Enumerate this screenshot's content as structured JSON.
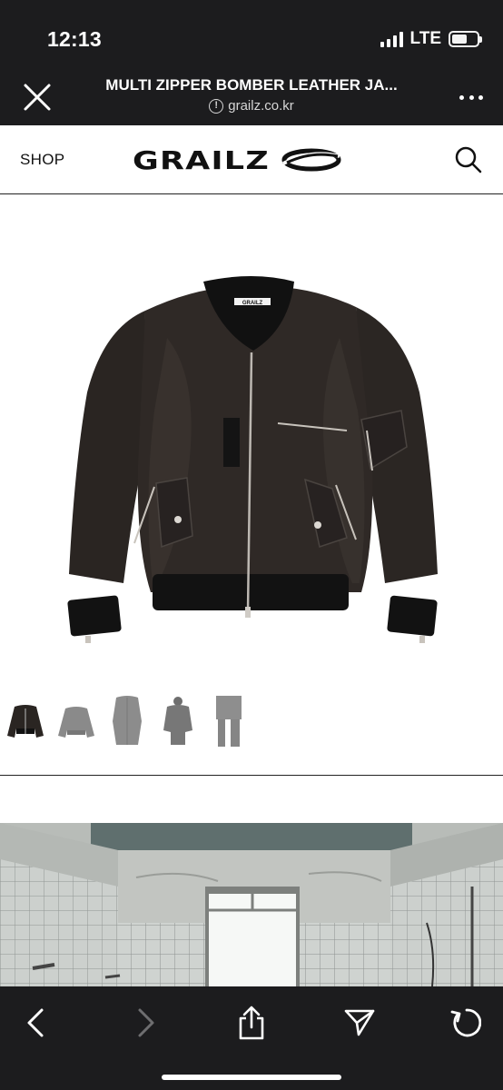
{
  "status_bar": {
    "time": "12:13",
    "network": "LTE"
  },
  "browser": {
    "page_title": "MULTI ZIPPER BOMBER LEATHER JA...",
    "url": "grailz.co.kr",
    "info_symbol": "!"
  },
  "site": {
    "shop_label": "SHOP",
    "logo_text": "GRAILZ",
    "icons": {
      "search": "search-icon",
      "close": "close-icon",
      "more": "more-icon"
    }
  },
  "product": {
    "collar_label": "GRAILZ",
    "thumbnail_count": 5
  },
  "toolbar": {
    "icons": [
      "back-icon",
      "forward-icon",
      "share-icon",
      "bookmark-arrow-icon",
      "reload-icon"
    ]
  },
  "colors": {
    "chrome": "#1c1c1e",
    "page": "#ffffff",
    "text": "#111111"
  }
}
